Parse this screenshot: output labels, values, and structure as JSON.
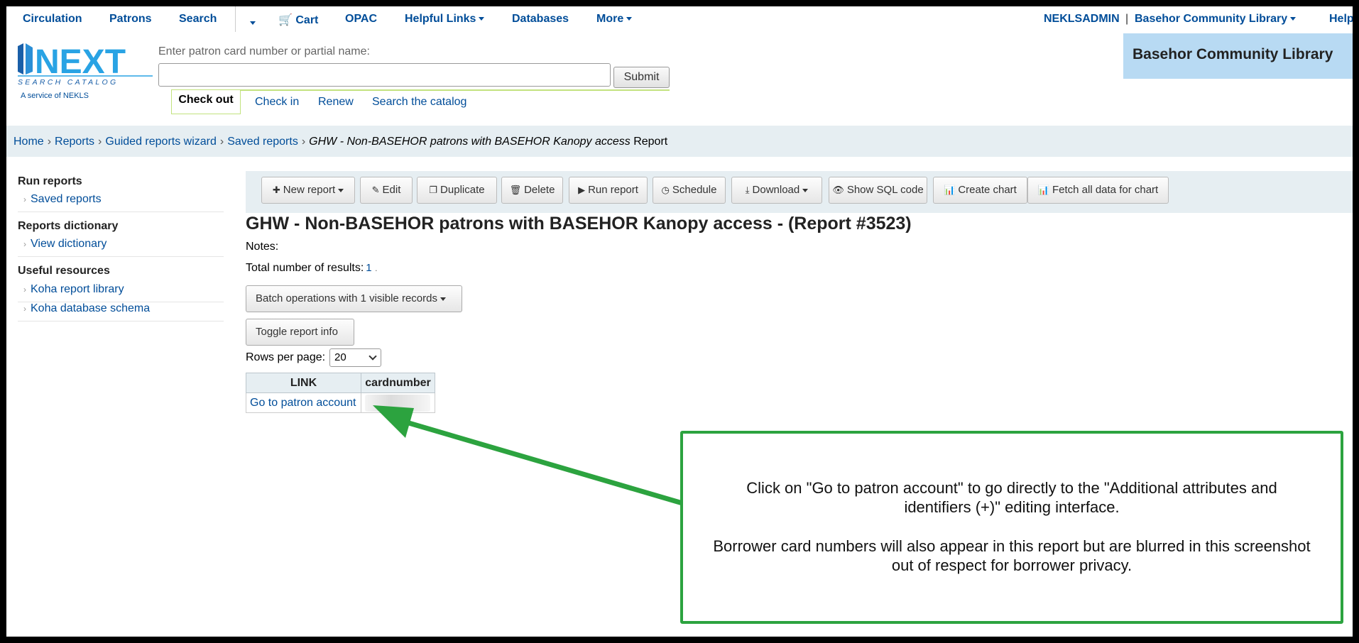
{
  "nav": {
    "items": [
      "Circulation",
      "Patrons",
      "Search",
      "Cart",
      "OPAC",
      "Helpful Links",
      "Databases",
      "More"
    ],
    "user": "NEKLSADMIN",
    "divider": "|",
    "library": "Basehor Community Library",
    "help": "Help"
  },
  "logo": {
    "text": "NEXT",
    "subtext": "SEARCH CATALOG",
    "service": "A service of NEKLS"
  },
  "patron_search": {
    "label": "Enter patron card number or partial name:",
    "value": "",
    "submit": "Submit"
  },
  "circ_tabs": [
    "Check out",
    "Check in",
    "Renew",
    "Search the catalog"
  ],
  "library_banner": "Basehor Community Library",
  "breadcrumb": {
    "items": [
      "Home",
      "Reports",
      "Guided reports wizard",
      "Saved reports"
    ],
    "current_italic": "GHW - Non-BASEHOR patrons with BASEHOR Kanopy access",
    "current_suffix": "Report",
    "separator": "›"
  },
  "sidebar": {
    "sections": [
      {
        "title": "Run reports",
        "links": [
          "Saved reports"
        ]
      },
      {
        "title": "Reports dictionary",
        "links": [
          "View dictionary"
        ]
      },
      {
        "title": "Useful resources",
        "links": [
          "Koha report library",
          "Koha database schema"
        ]
      }
    ]
  },
  "toolbar": [
    "New report",
    "Edit",
    "Duplicate",
    "Delete",
    "Run report",
    "Schedule",
    "Download",
    "Show SQL code",
    "Create chart",
    "Fetch all data for chart"
  ],
  "report": {
    "title": "GHW - Non-BASEHOR patrons with BASEHOR Kanopy access - (Report #3523)",
    "notes_label": "Notes:",
    "total_label": "Total number of results:",
    "total_value": "1",
    "total_suffix": ".",
    "batch_button": "Batch operations with 1 visible records",
    "toggle_button": "Toggle report info",
    "rows_label": "Rows per page:",
    "rows_value": "20",
    "columns": [
      "LINK",
      "cardnumber"
    ],
    "rows": [
      [
        "Go to patron account",
        ""
      ]
    ]
  },
  "callout": {
    "p1": "Click on \"Go to patron account\" to go directly to the \"Additional attributes and identifiers (+)\" editing interface.",
    "p2": "Borrower card numbers will also appear in this report but are blurred in this screenshot out of respect for borrower privacy.",
    "color": "#2ca33f"
  }
}
